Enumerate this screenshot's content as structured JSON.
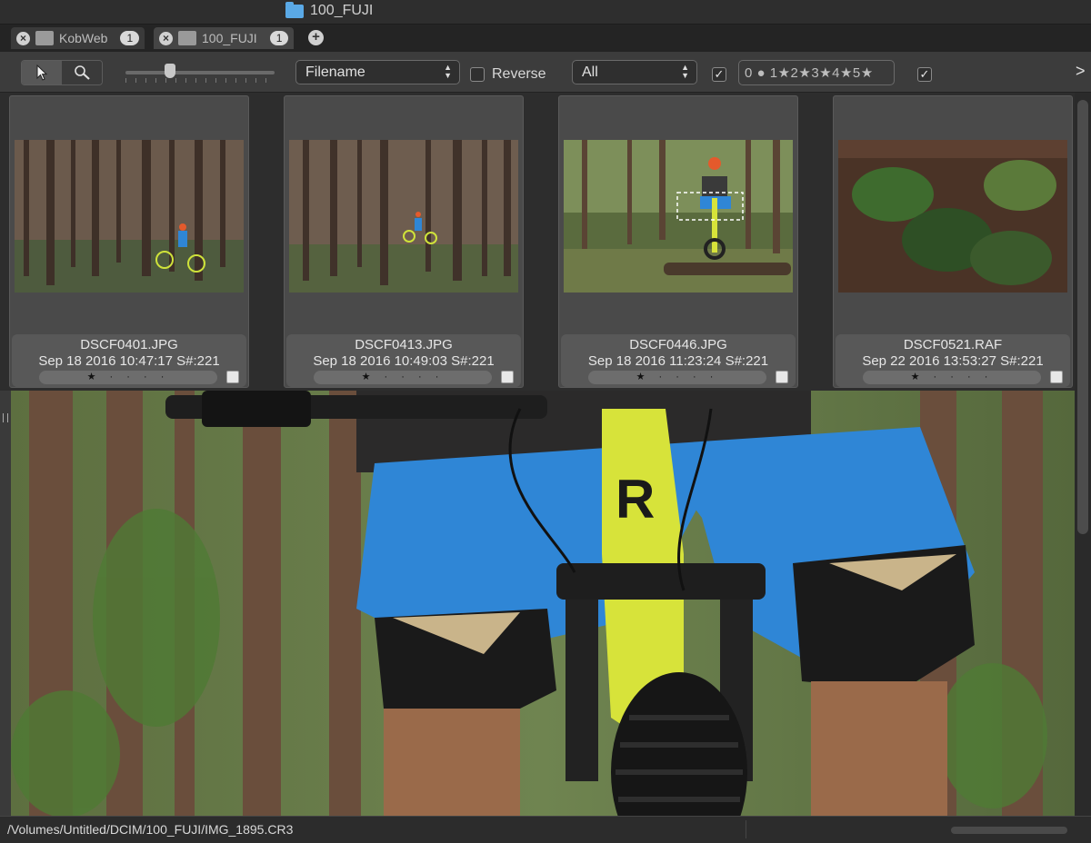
{
  "window": {
    "title": "100_FUJI"
  },
  "tabs": [
    {
      "label": "KobWeb",
      "count": "1"
    },
    {
      "label": "100_FUJI",
      "count": "1"
    }
  ],
  "toolbar": {
    "sort_field": "Filename",
    "reverse_label": "Reverse",
    "filter": "All",
    "rating_filter": "0 ● 1★2★3★4★5★",
    "overflow": ">"
  },
  "thumbnails": [
    {
      "filename": "DSCF0401.JPG",
      "info": "Sep 18 2016 10:47:17 S#:221",
      "rating": "★ · · · ·"
    },
    {
      "filename": "DSCF0413.JPG",
      "info": "Sep 18 2016 10:49:03 S#:221",
      "rating": "★ · · · ·"
    },
    {
      "filename": "DSCF0446.JPG",
      "info": "Sep 18 2016 11:23:24 S#:221",
      "rating": "★ · · · ·"
    },
    {
      "filename": "DSCF0521.RAF",
      "info": "Sep 22 2016 13:53:27 S#:221",
      "rating": "★ · · · ·"
    }
  ],
  "status": {
    "path": "/Volumes/Untitled/DCIM/100_FUJI/IMG_1895.CR3"
  },
  "colors": {
    "folder_accent": "#5aa9e6",
    "bike_yellow": "#d7e33a",
    "shorts_blue": "#2f86d6"
  }
}
